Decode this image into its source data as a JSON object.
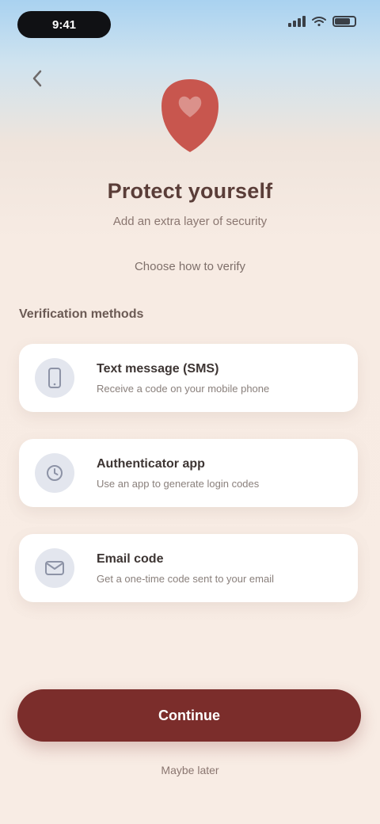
{
  "status_bar": {
    "time": "9:41",
    "battery_level": 0.8
  },
  "header": {
    "back_icon": "chevron-left-icon"
  },
  "hero": {
    "icon": "heart-shield-icon",
    "accent_color": "#c8564e",
    "title": "Protect yourself",
    "subtitle": "Add an extra layer of security",
    "hint": "Choose how to verify"
  },
  "section": {
    "label": "Verification methods"
  },
  "options": [
    {
      "icon": "phone-icon",
      "title": "Text message (SMS)",
      "desc": "Receive a code on your mobile phone"
    },
    {
      "icon": "authenticator-icon",
      "title": "Authenticator app",
      "desc": "Use an app to generate login codes"
    },
    {
      "icon": "mail-icon",
      "title": "Email code",
      "desc": "Get a one-time code sent to your email"
    }
  ],
  "primary_button": {
    "label": "Continue",
    "color": "#7b2d2b"
  },
  "footer": {
    "link": "Maybe later"
  }
}
